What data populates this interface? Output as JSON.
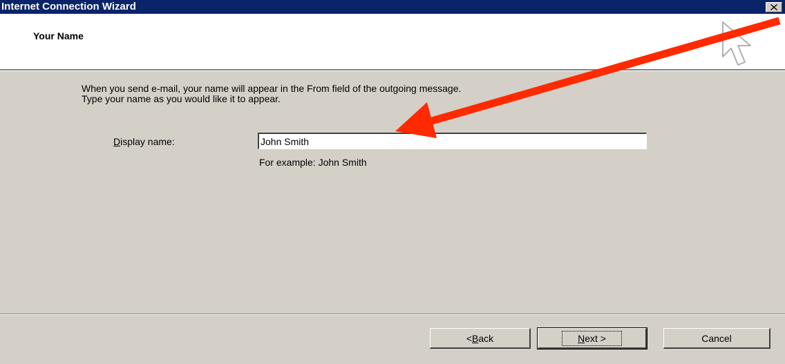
{
  "window": {
    "title": "Internet Connection Wizard",
    "close_glyph": "✕"
  },
  "header": {
    "title": "Your Name"
  },
  "instructions": {
    "line1": "When you send e-mail, your name will appear in the From field of the outgoing message.",
    "line2": "Type your name as you would like it to appear."
  },
  "display_name": {
    "label_accesskey": "D",
    "label_rest": "isplay name:",
    "value": "John Smith",
    "example": "For example: John Smith"
  },
  "buttons": {
    "back_prefix": "< ",
    "back_accesskey": "B",
    "back_rest": "ack",
    "next_accesskey": "N",
    "next_rest": "ext >",
    "cancel": "Cancel"
  },
  "annotation": {
    "arrow_color": "#ff2a00",
    "icon": "mouse-pointer-icon"
  }
}
